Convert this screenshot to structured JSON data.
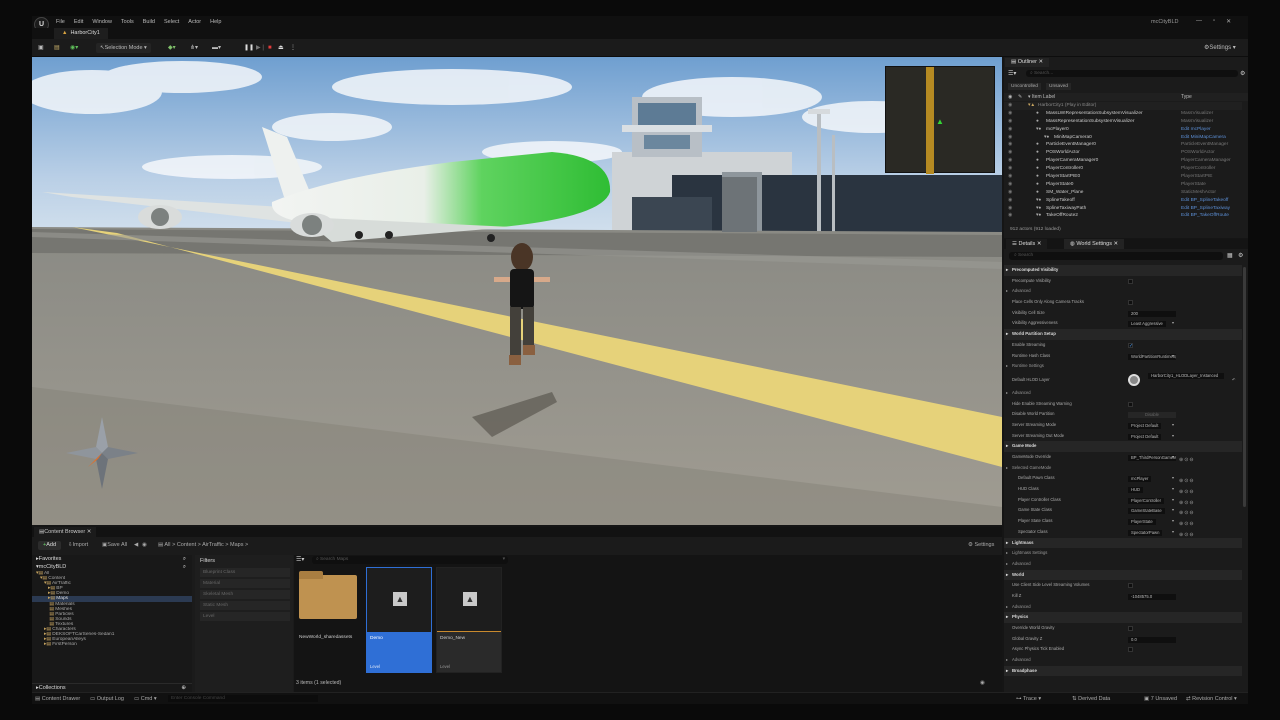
{
  "menubar": {
    "logo": "U",
    "items": [
      "File",
      "Edit",
      "Window",
      "Tools",
      "Build",
      "Select",
      "Actor",
      "Help"
    ],
    "project": "mcCityBLD",
    "window_controls": [
      "—",
      "▫",
      "✕"
    ]
  },
  "level_tab": "HarborCity1",
  "toolbar": {
    "mode": "Selection Mode",
    "settings": "Settings"
  },
  "content_browser": {
    "tab": "Content Browser",
    "add": "Add",
    "import": "Import",
    "save_all": "Save All",
    "breadcrumb": [
      "All",
      "Content",
      "AirTraffic",
      "Maps"
    ],
    "settings": "Settings",
    "favorites": "Favorites",
    "root": "mcCityBLD",
    "tree": [
      "All",
      "Content",
      "AirTraffic",
      "BP",
      "Demo",
      "Maps",
      "Materials",
      "Meshes",
      "Particles",
      "Sounds",
      "Textures",
      "Characters",
      "DEKSOFTCarSeries-Sedan1",
      "EuropeanAlleys",
      "FirstPerson"
    ],
    "collections": "Collections",
    "filters_title": "Filters",
    "filters": [
      "Blueprint Class",
      "Material",
      "Skeletal Mesh",
      "Static Mesh",
      "Level"
    ],
    "search_placeholder": "Search Maps",
    "assets": [
      {
        "name": "NewWorld_sharedassets",
        "type": ""
      },
      {
        "name": "Demo",
        "type": "Level"
      },
      {
        "name": "Demo_New",
        "type": "Level"
      }
    ],
    "items_status": "3 items (1 selected)"
  },
  "statusbar": {
    "content_drawer": "Content Drawer",
    "output_log": "Output Log",
    "cmd": "Cmd",
    "console_placeholder": "Enter Console Command",
    "trace": "Trace",
    "derived_data": "Derived Data",
    "unsaved": "7 Unsaved",
    "revision_control": "Revision Control"
  },
  "outliner": {
    "tab": "Outliner",
    "search_placeholder": "Search...",
    "filter_tags": [
      "Uncontrolled",
      "Unsaved"
    ],
    "col_label": "Item Label",
    "col_type": "Type",
    "rows": [
      {
        "label": "HarborCity1 (Play in Editor)",
        "type": "",
        "indent": 0,
        "link": false
      },
      {
        "label": "MassLWIRepresentationSubsystemVisualizer",
        "type": "MassVisualizer",
        "indent": 1,
        "link": false
      },
      {
        "label": "MassRepresentationSubsystemVisualizer",
        "type": "MassVisualizer",
        "indent": 1,
        "link": false
      },
      {
        "label": "mcPlayer0",
        "type": "Edit mcPlayer",
        "indent": 1,
        "link": true
      },
      {
        "label": "MiniMapCamera0",
        "type": "Edit MiniMapCamera",
        "indent": 2,
        "link": true
      },
      {
        "label": "ParticleEventManager0",
        "type": "ParticleEventManager",
        "indent": 1,
        "link": false
      },
      {
        "label": "POSWorldActor",
        "type": "POSWorldActor",
        "indent": 1,
        "link": false
      },
      {
        "label": "PlayerCameraManager0",
        "type": "PlayerCameraManager",
        "indent": 1,
        "link": false
      },
      {
        "label": "PlayerController0",
        "type": "PlayerController",
        "indent": 1,
        "link": false
      },
      {
        "label": "PlayerStartPIE0",
        "type": "PlayerStartPIE",
        "indent": 1,
        "link": false
      },
      {
        "label": "PlayerState0",
        "type": "PlayerState",
        "indent": 1,
        "link": false
      },
      {
        "label": "SM_Water_Plane",
        "type": "StaticMeshActor",
        "indent": 1,
        "link": false
      },
      {
        "label": "SplineTakeoff",
        "type": "Edit BP_SplineTakeoff",
        "indent": 1,
        "link": true
      },
      {
        "label": "SplineTaxiwayPath",
        "type": "Edit BP_SplineTaxiway",
        "indent": 1,
        "link": true
      },
      {
        "label": "TakeOffRoute2",
        "type": "Edit BP_TakeOffRoute",
        "indent": 1,
        "link": true
      }
    ],
    "count": "912 actors (912 loaded)"
  },
  "details": {
    "tab_details": "Details",
    "tab_world": "World Settings",
    "search_placeholder": "Search",
    "rows": [
      {
        "kind": "sec",
        "label": "Precomputed Visibility"
      },
      {
        "kind": "prop",
        "label": "Precompute Visibility",
        "ctl": "check",
        "value": ""
      },
      {
        "kind": "sub",
        "label": "Advanced"
      },
      {
        "kind": "prop",
        "label": "Place Cells Only Along Camera Tracks",
        "ctl": "check",
        "value": ""
      },
      {
        "kind": "prop",
        "label": "Visibility Cell Size",
        "ctl": "input",
        "value": "200"
      },
      {
        "kind": "prop",
        "label": "Visibility Aggressiveness",
        "ctl": "select",
        "value": "Least Aggressive"
      },
      {
        "kind": "sec",
        "label": "World Partition Setup"
      },
      {
        "kind": "prop",
        "label": "Enable Streaming",
        "ctl": "checked",
        "value": "✓"
      },
      {
        "kind": "prop",
        "label": "Runtime Hash Class",
        "ctl": "select",
        "value": "WorldPartitionRuntimeSpatialHash"
      },
      {
        "kind": "sub",
        "label": "Runtime Settings"
      },
      {
        "kind": "prop",
        "label": "Default HLOD Layer",
        "ctl": "hlod",
        "value": "HarborCity1_HLODLayer_Instanced"
      },
      {
        "kind": "sub",
        "label": "Advanced"
      },
      {
        "kind": "prop",
        "label": "Hide Enable Streaming Warning",
        "ctl": "check",
        "value": ""
      },
      {
        "kind": "prop",
        "label": "Disable World Partition",
        "ctl": "button",
        "value": "Disable"
      },
      {
        "kind": "prop",
        "label": "Server Streaming Mode",
        "ctl": "select",
        "value": "Project Default"
      },
      {
        "kind": "prop",
        "label": "Server Streaming Out Mode",
        "ctl": "select",
        "value": "Project Default"
      },
      {
        "kind": "sec",
        "label": "Game Mode"
      },
      {
        "kind": "prop",
        "label": "GameMode Override",
        "ctl": "select",
        "value": "BP_ThirdPersonGameMode"
      },
      {
        "kind": "sub",
        "label": "Selected GameMode"
      },
      {
        "kind": "prop2",
        "label": "Default Pawn Class",
        "ctl": "select",
        "value": "mcPlayer"
      },
      {
        "kind": "prop2",
        "label": "HUD Class",
        "ctl": "select",
        "value": "HUD"
      },
      {
        "kind": "prop2",
        "label": "Player Controller Class",
        "ctl": "select",
        "value": "PlayerController"
      },
      {
        "kind": "prop2",
        "label": "Game State Class",
        "ctl": "select",
        "value": "GameStateBase"
      },
      {
        "kind": "prop2",
        "label": "Player State Class",
        "ctl": "select",
        "value": "PlayerState"
      },
      {
        "kind": "prop2",
        "label": "Spectator Class",
        "ctl": "select",
        "value": "SpectatorPawn"
      },
      {
        "kind": "sec",
        "label": "Lightmass"
      },
      {
        "kind": "sub",
        "label": "Lightmass Settings"
      },
      {
        "kind": "sub",
        "label": "Advanced"
      },
      {
        "kind": "sec",
        "label": "World"
      },
      {
        "kind": "prop",
        "label": "Use Client Side Level Streaming Volumes",
        "ctl": "check",
        "value": ""
      },
      {
        "kind": "prop",
        "label": "Kill Z",
        "ctl": "input",
        "value": "-1048575.0"
      },
      {
        "kind": "sub",
        "label": "Advanced"
      },
      {
        "kind": "sec",
        "label": "Physics"
      },
      {
        "kind": "prop",
        "label": "Override World Gravity",
        "ctl": "check",
        "value": ""
      },
      {
        "kind": "prop",
        "label": "Global Gravity Z",
        "ctl": "input",
        "value": "0.0"
      },
      {
        "kind": "prop",
        "label": "Async Physics Tick Enabled",
        "ctl": "check",
        "value": ""
      },
      {
        "kind": "sub",
        "label": "Advanced"
      },
      {
        "kind": "sec",
        "label": "Broadphase"
      }
    ]
  },
  "colors": {
    "accent": "#2f6fd6",
    "plane_green": "#36c23a",
    "runway_stripe": "#e6d27a",
    "link": "#5c8fd6"
  }
}
